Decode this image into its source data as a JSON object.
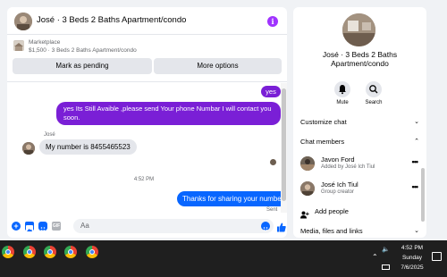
{
  "chat": {
    "title": "José · 3 Beds 2 Baths Apartment/condo",
    "info_icon": "info-icon",
    "listing": {
      "label": "Marketplace",
      "subtitle": "$1,500 · 3 Beds 2 Baths Apartment/condo",
      "mark_pending_label": "Mark as pending",
      "more_options_label": "More options"
    },
    "messages": {
      "out_yes": "yes",
      "out_long": "yes Its Still Avaible ,please send Your phone Numbar I will contact you soon.",
      "in_sender": "José",
      "in_text": "My number is 8455465523",
      "time_divider": "4:52 PM",
      "out_thanks": "Thanks for sharing your number",
      "sent_status": "Sent"
    },
    "composer": {
      "placeholder": "Aa"
    }
  },
  "panel": {
    "name": "José · 3 Beds 2 Baths Apartment/condo",
    "actions": [
      {
        "label": "Mute",
        "icon": "bell-icon"
      },
      {
        "label": "Search",
        "icon": "search-icon"
      }
    ],
    "sections": {
      "customize": "Customize chat",
      "members": "Chat members",
      "media": "Media, files and links"
    },
    "members": [
      {
        "name": "Javon Ford",
        "subtitle": "Added by José Ich Tiul"
      },
      {
        "name": "José Ich Tiul",
        "subtitle": "Group creator"
      }
    ],
    "add_people": "Add people"
  },
  "taskbar": {
    "app_icon": "chrome-icon",
    "time": "4:52 PM",
    "day": "Sunday",
    "date": "7/6/2025"
  },
  "colors": {
    "outgoing_purple": "#7a1fd6",
    "outgoing_blue": "#0866ff",
    "incoming_gray": "#e4e6eb",
    "info_purple": "#a033ff"
  }
}
